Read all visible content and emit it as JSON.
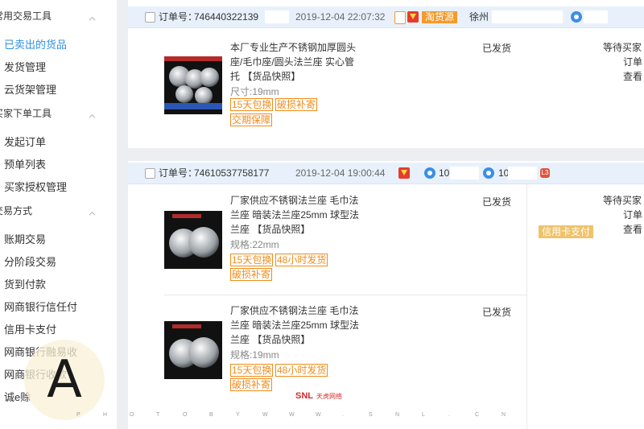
{
  "sidebar": {
    "sections": [
      {
        "title": "常用交易工具",
        "items": [
          "已卖出的货品",
          "发货管理",
          "云货架管理"
        ],
        "active": 0
      },
      {
        "title": "买家下单工具",
        "items": [
          "发起订单",
          "预单列表",
          "买家授权管理"
        ]
      },
      {
        "title": "交易方式",
        "items": [
          "账期交易",
          "分阶段交易",
          "货到付款",
          "网商银行信任付",
          "信用卡支付",
          "网商银行融易收",
          "网商银行收款",
          "诚e赊"
        ]
      }
    ]
  },
  "orders": [
    {
      "label": "订单号：",
      "number": "746440322139",
      "time": "2019-12-04 22:07:32",
      "source_badge": "淘货源",
      "location": "徐州",
      "items": [
        {
          "title": "本厂专业生产不锈钢加厚圆头座/毛巾座/圆头法兰座 实心管托 【货品快照】",
          "spec": "尺寸:19mm",
          "tags": [
            "15天包换",
            "破损补寄",
            "交期保障"
          ],
          "status": "已发货"
        }
      ],
      "right": [
        "等待买家",
        "订单",
        "查看"
      ]
    },
    {
      "label": "订单号：",
      "number": "74610537758177",
      "time": "2019-12-04 19:00:44",
      "ww1": "10",
      "ww2": "10",
      "level": "L3",
      "payment_badge": "信用卡支付",
      "items": [
        {
          "title": "厂家供应不锈钢法兰座 毛巾法兰座 暗装法兰座25mm 球型法兰座 【货品快照】",
          "spec": "规格:22mm",
          "tags": [
            "15天包换",
            "48小时发货",
            "破损补寄"
          ],
          "status": "已发货"
        },
        {
          "title": "厂家供应不锈钢法兰座 毛巾法兰座 暗装法兰座25mm 球型法兰座 【货品快照】",
          "spec": "规格:19mm",
          "tags": [
            "15天包换",
            "48小时发货",
            "破损补寄"
          ],
          "status": "已发货"
        }
      ],
      "right": [
        "等待买家",
        "订单",
        "查看"
      ]
    }
  ],
  "watermark": {
    "badge_letter": "A",
    "chars": [
      "P",
      "H",
      "O",
      "T",
      "O",
      "B",
      "Y",
      "W",
      "W",
      "W",
      ".",
      "S",
      "N",
      "L",
      ".",
      "C",
      "N"
    ],
    "logo_main": "SNL",
    "logo_sub": "天虎网络"
  },
  "colors": {
    "accent": "#2e8fe6",
    "tag_orange": "#f08c1a",
    "head_bg": "#e8f1fb",
    "credit_badge": "#f0c26a"
  }
}
